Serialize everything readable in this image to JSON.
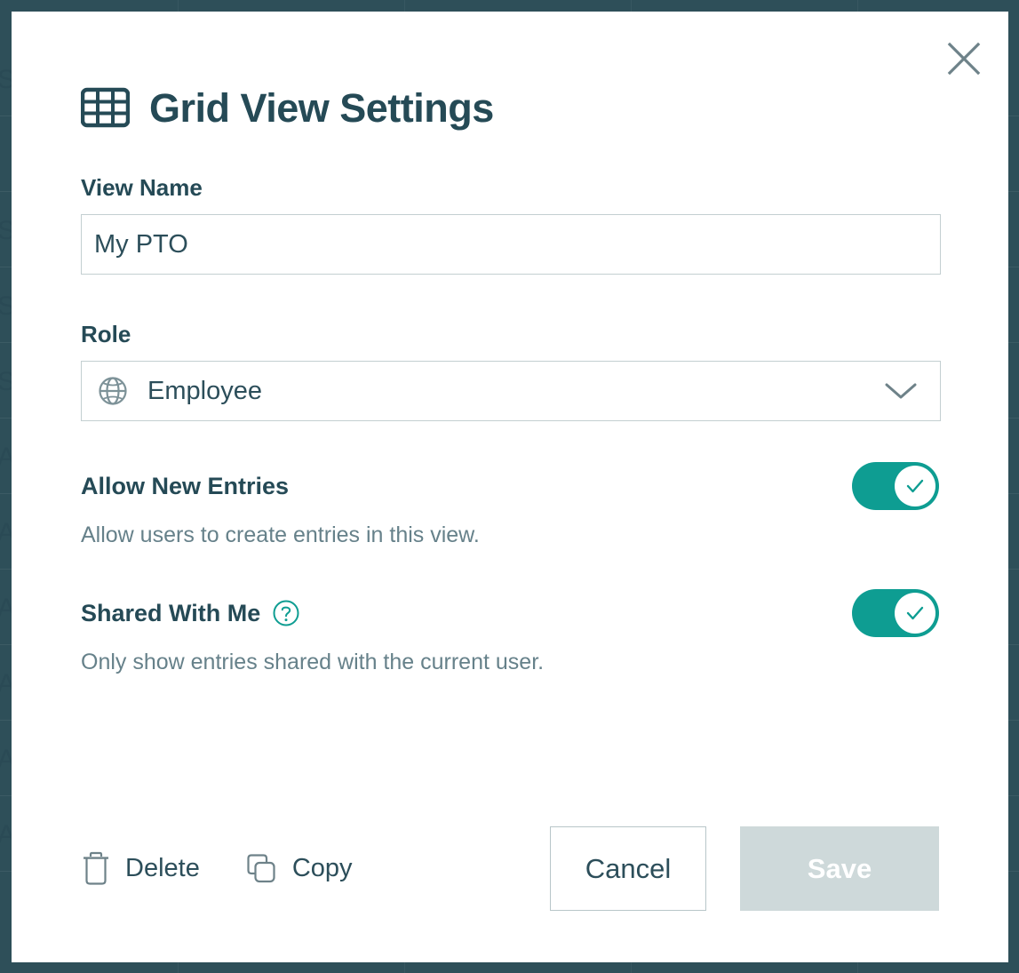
{
  "colors": {
    "backdrop": "#2e4f59",
    "heading": "#254a56",
    "muted_text": "#66818a",
    "accent_teal": "#0e9d92",
    "border": "#c3cfd1",
    "save_disabled_bg": "#ced9da",
    "icon_gray": "#6e8289"
  },
  "modal": {
    "title": "Grid View Settings",
    "title_icon": "grid-table-icon",
    "close_icon": "close-icon"
  },
  "view_name": {
    "label": "View Name",
    "value": "My PTO",
    "placeholder": "View Name"
  },
  "role": {
    "label": "Role",
    "value": "Employee",
    "icon": "globe-icon",
    "chevron": "chevron-down-icon",
    "options": [
      "Employee"
    ]
  },
  "allow_new_entries": {
    "title": "Allow New Entries",
    "description": "Allow users to create entries in this view.",
    "enabled": true,
    "toggle_icon": "check-icon"
  },
  "shared_with_me": {
    "title": "Shared With Me",
    "description": "Only show entries shared with the current user.",
    "enabled": true,
    "help_icon": "question-circle-icon",
    "toggle_icon": "check-icon"
  },
  "footer": {
    "delete_label": "Delete",
    "delete_icon": "trash-icon",
    "copy_label": "Copy",
    "copy_icon": "copy-icon",
    "cancel_label": "Cancel",
    "save_label": "Save",
    "save_disabled": true
  },
  "backdrop_text": {
    "letters": [
      "S",
      "S",
      "S",
      "S",
      "A",
      "A",
      "A",
      "A",
      "A",
      "A",
      "A",
      "A"
    ]
  }
}
